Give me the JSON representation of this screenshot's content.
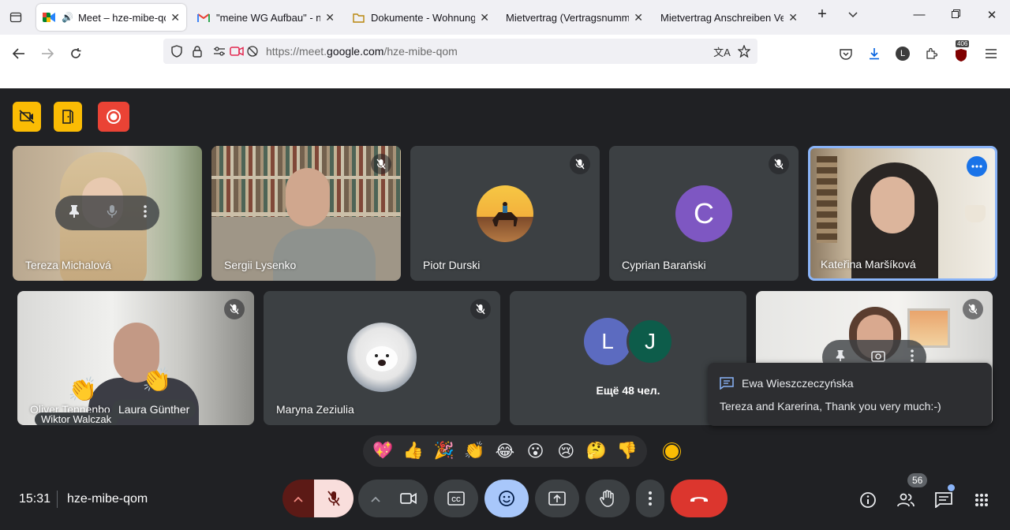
{
  "browser": {
    "tabs": [
      {
        "title": "Meet – hze-mibe-qom",
        "favicon": "meet-icon",
        "active": true
      },
      {
        "title": "\"meine WG Aufbau\" - neu",
        "favicon": "gmail-icon"
      },
      {
        "title": "Dokumente - Wohnungsg",
        "favicon": "folder-icon"
      },
      {
        "title": "Mietvertrag (Vertragsnummer",
        "favicon": ""
      },
      {
        "title": "Mietvertrag Anschreiben Verse",
        "favicon": ""
      }
    ],
    "url_prefix": "https://meet.",
    "url_domain": "google.com",
    "url_path": "/hze-mibe-qom",
    "profile_initial": "L",
    "extension_badge": "406"
  },
  "meeting": {
    "participants_row1": [
      {
        "name": "Tereza Michalová",
        "muted": false
      },
      {
        "name": "Sergii Lysenko",
        "muted": true
      },
      {
        "name": "Piotr Durski",
        "muted": true
      },
      {
        "name": "Cyprian Barański",
        "muted": true,
        "initial": "C",
        "color": "#7e57c2"
      },
      {
        "name": "Kateřina Maršíková",
        "muted": false,
        "active_speaker": true
      }
    ],
    "participants_row2": [
      {
        "name": "Oliver Tennenbo",
        "muted": true
      },
      {
        "name": "Maryna Zeziulia",
        "muted": true
      },
      {
        "name": "Ещё 48 чел.",
        "initials": [
          "L",
          "J"
        ]
      },
      {
        "name": "Ewa Wieszczeczyńska",
        "muted": true
      }
    ],
    "hand_raised": [
      "Laura Günther",
      "Wiktor Walczak"
    ],
    "chat": {
      "sender": "Ewa Wieszczeczyńska",
      "message": "Tereza and Karerina, Thank you very much:-)"
    },
    "reactions": [
      "💖",
      "👍",
      "🎉",
      "👏",
      "😂",
      "😮",
      "😢",
      "🤔",
      "👎"
    ],
    "time": "15:31",
    "meeting_code": "hze-mibe-qom",
    "participants_count": "56",
    "colors": {
      "accent": "#8ab4f8",
      "end_call": "#ea4335",
      "mic_off": "#f9dedc",
      "yellow": "#fbbc04"
    }
  }
}
